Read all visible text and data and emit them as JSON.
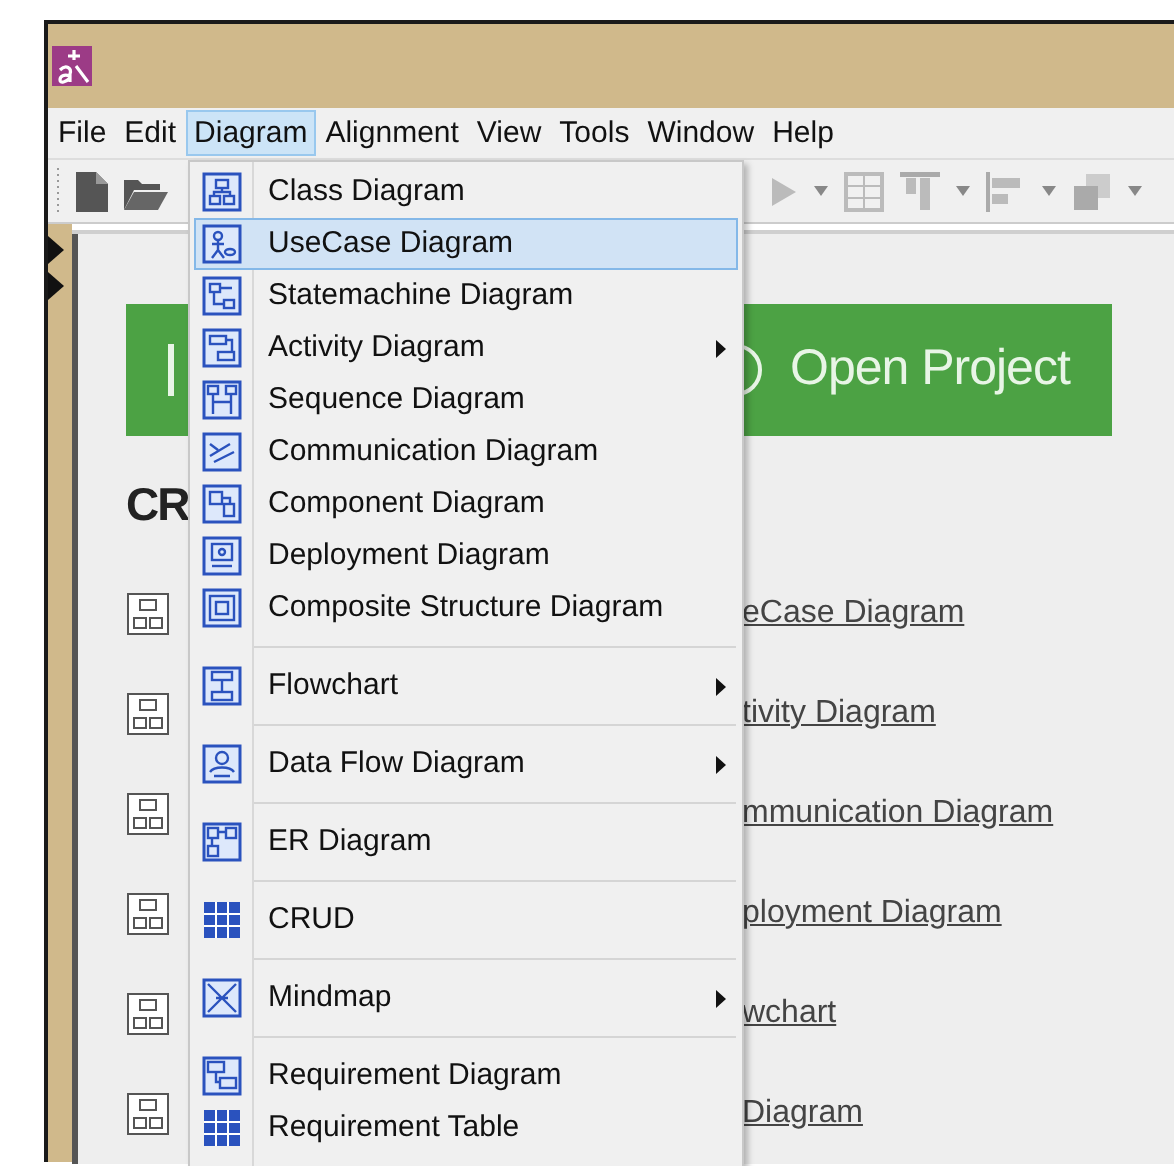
{
  "menu_bar": [
    {
      "label": "File",
      "selected": false
    },
    {
      "label": "Edit",
      "selected": false
    },
    {
      "label": "Diagram",
      "selected": true
    },
    {
      "label": "Alignment",
      "selected": false
    },
    {
      "label": "View",
      "selected": false
    },
    {
      "label": "Tools",
      "selected": false
    },
    {
      "label": "Window",
      "selected": false
    },
    {
      "label": "Help",
      "selected": false
    }
  ],
  "diagram_menu": {
    "items": [
      {
        "label": "Class Diagram",
        "selected": false,
        "submenu": false,
        "separator_before": false
      },
      {
        "label": "UseCase Diagram",
        "selected": true,
        "submenu": false,
        "separator_before": false
      },
      {
        "label": "Statemachine Diagram",
        "selected": false,
        "submenu": false,
        "separator_before": false
      },
      {
        "label": "Activity Diagram",
        "selected": false,
        "submenu": true,
        "separator_before": false
      },
      {
        "label": "Sequence Diagram",
        "selected": false,
        "submenu": false,
        "separator_before": false
      },
      {
        "label": "Communication Diagram",
        "selected": false,
        "submenu": false,
        "separator_before": false
      },
      {
        "label": "Component Diagram",
        "selected": false,
        "submenu": false,
        "separator_before": false
      },
      {
        "label": "Deployment Diagram",
        "selected": false,
        "submenu": false,
        "separator_before": false
      },
      {
        "label": "Composite Structure Diagram",
        "selected": false,
        "submenu": false,
        "separator_before": false
      },
      {
        "label": "Flowchart",
        "selected": false,
        "submenu": true,
        "separator_before": true
      },
      {
        "label": "Data Flow Diagram",
        "selected": false,
        "submenu": true,
        "separator_before": true
      },
      {
        "label": "ER Diagram",
        "selected": false,
        "submenu": false,
        "separator_before": true
      },
      {
        "label": "CRUD",
        "selected": false,
        "submenu": false,
        "separator_before": true
      },
      {
        "label": "Mindmap",
        "selected": false,
        "submenu": true,
        "separator_before": true
      },
      {
        "label": "Requirement Diagram",
        "selected": false,
        "submenu": false,
        "separator_before": true
      },
      {
        "label": "Requirement Table",
        "selected": false,
        "submenu": false,
        "separator_before": false
      }
    ]
  },
  "start_page": {
    "open_project": "Open Project",
    "heading": "CR",
    "links": [
      "eCase Diagram",
      "tivity Diagram",
      "mmunication Diagram",
      "ployment Diagram",
      "wchart",
      "Diagram"
    ]
  }
}
